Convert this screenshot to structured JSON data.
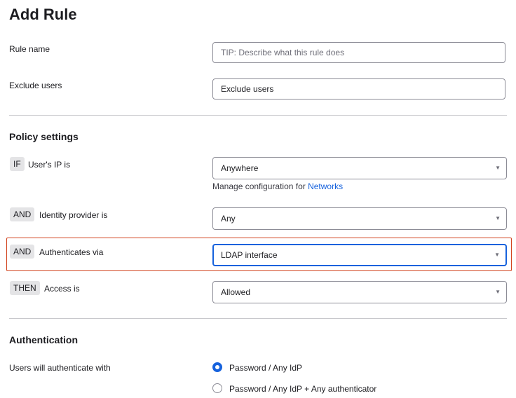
{
  "page": {
    "title": "Add Rule"
  },
  "rule_name": {
    "label": "Rule name",
    "placeholder": "TIP: Describe what this rule does",
    "value": ""
  },
  "exclude_users": {
    "label": "Exclude users",
    "value": "Exclude users"
  },
  "policy_settings": {
    "heading": "Policy settings",
    "conditions": [
      {
        "operator": "IF",
        "label": "User's IP is",
        "value": "Anywhere"
      },
      {
        "operator": "AND",
        "label": "Identity provider is",
        "value": "Any"
      },
      {
        "operator": "AND",
        "label": "Authenticates via",
        "value": "LDAP interface"
      },
      {
        "operator": "THEN",
        "label": "Access is",
        "value": "Allowed"
      }
    ],
    "helper_text": "Manage configuration for",
    "helper_link": "Networks"
  },
  "authentication": {
    "heading": "Authentication",
    "label": "Users will authenticate with",
    "options": [
      {
        "label": "Password / Any IdP",
        "selected": true
      },
      {
        "label": "Password / Any IdP + Any authenticator",
        "selected": false
      }
    ]
  },
  "colors": {
    "accent": "#1662dd",
    "highlight_border": "#d2441f"
  },
  "icons": {
    "select_caret": "chevron-down-icon"
  }
}
